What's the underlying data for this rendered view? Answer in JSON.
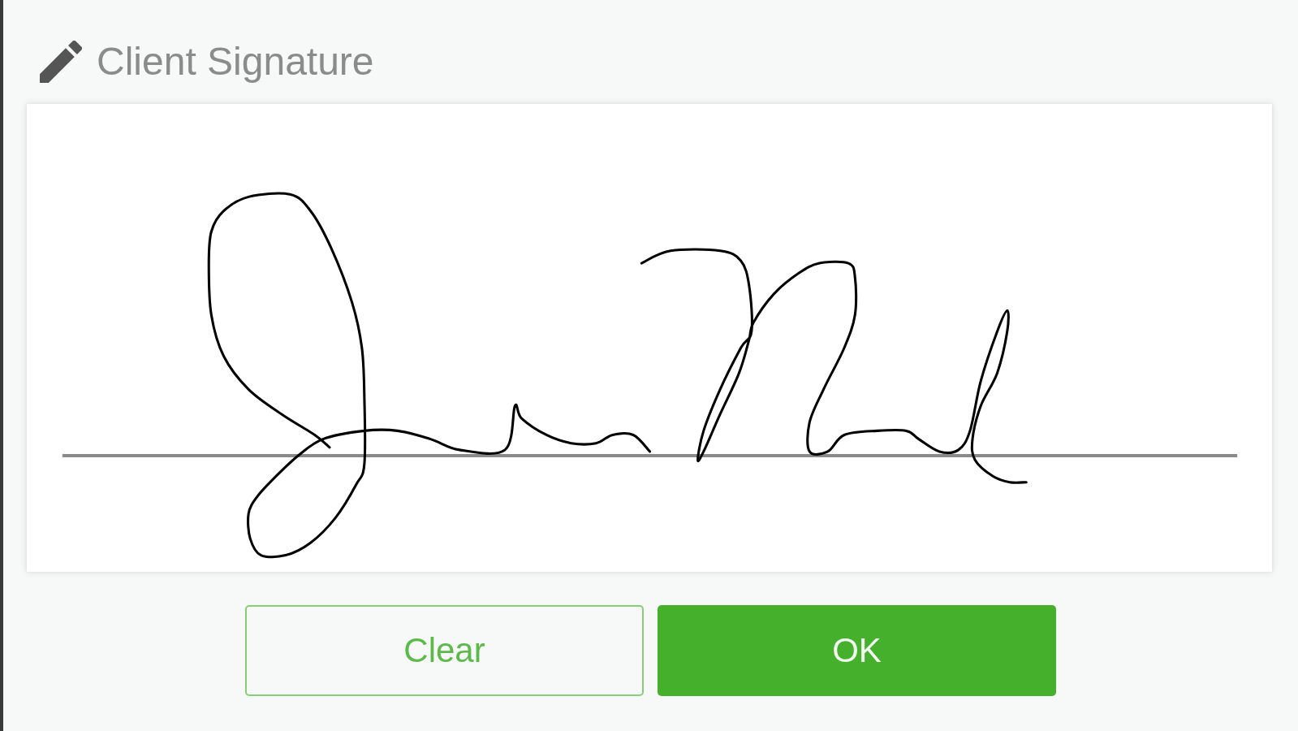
{
  "header": {
    "title": "Client Signature"
  },
  "buttons": [
    {
      "label": "Clear",
      "kind": "outline"
    },
    {
      "label": "OK",
      "kind": "primary"
    }
  ]
}
